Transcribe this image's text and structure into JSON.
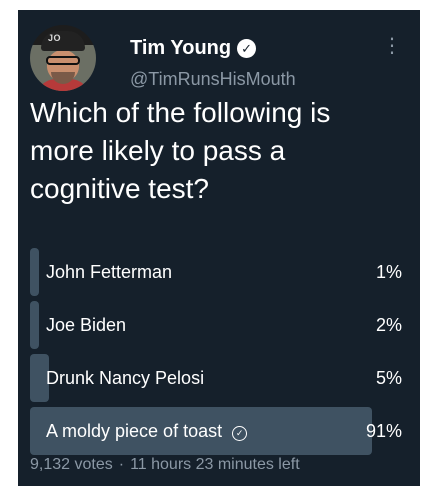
{
  "tweet": {
    "display_name": "Tim Young",
    "handle": "@TimRunsHisMouth",
    "avatar_cap_text": "JO",
    "question": "Which of the following is more likely to pass a cognitive test?"
  },
  "poll": {
    "options": [
      {
        "label": "John Fetterman",
        "percent": "1%",
        "share": 0.01
      },
      {
        "label": "Joe Biden",
        "percent": "2%",
        "share": 0.02
      },
      {
        "label": "Drunk Nancy Pelosi",
        "percent": "5%",
        "share": 0.05
      },
      {
        "label": "A moldy piece of toast",
        "percent": "91%",
        "share": 0.91,
        "winner": true
      }
    ],
    "votes": "9,132 votes",
    "separator": "·",
    "time_left": "11 hours 23 minutes left"
  },
  "colors": {
    "background": "#15202b",
    "bar": "#3f5262",
    "secondary_text": "#8b98a5"
  },
  "icons": {
    "verified": "verified-badge-icon",
    "more": "more-options-icon",
    "winner": "check-circle-icon"
  }
}
